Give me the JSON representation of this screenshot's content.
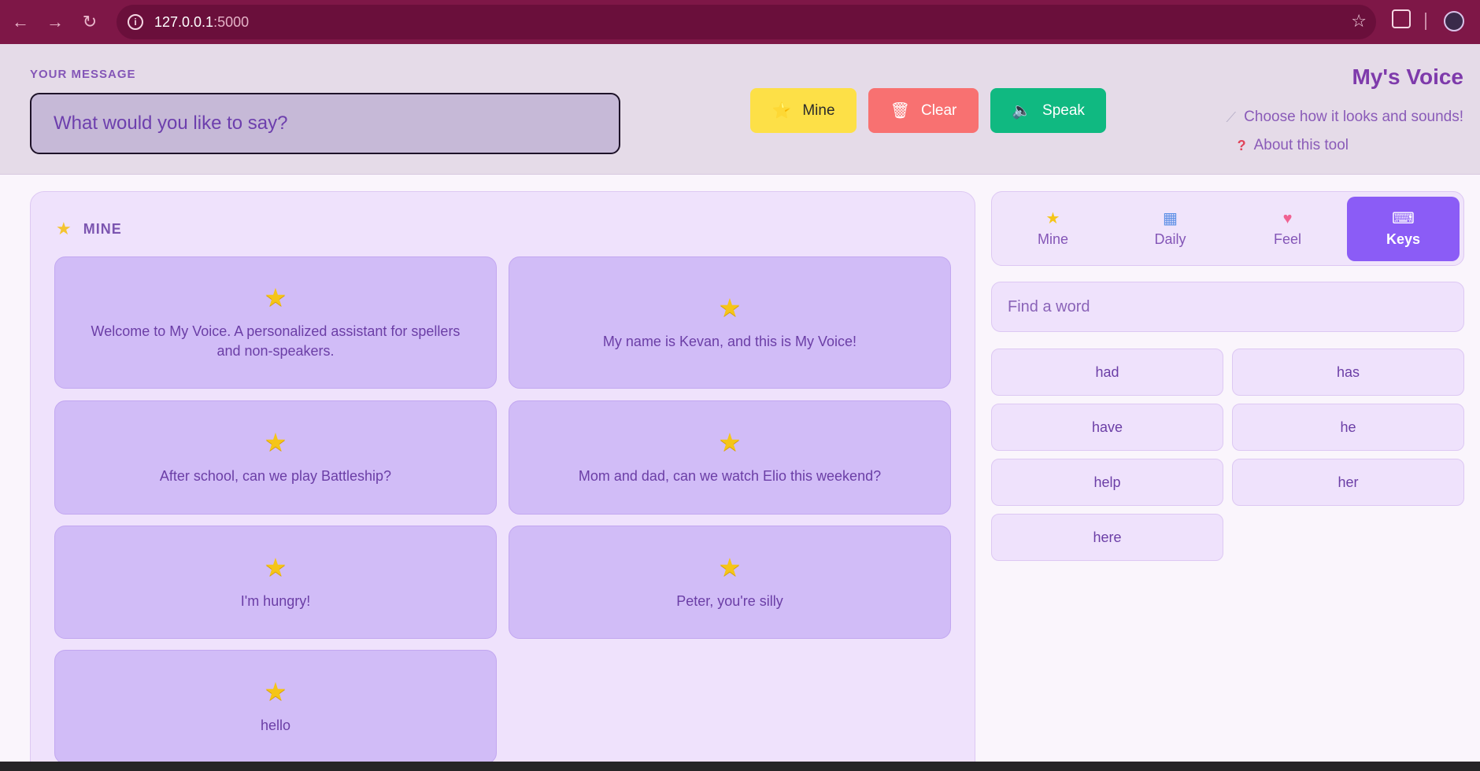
{
  "browser": {
    "url_host": "127.0.0.1",
    "url_port": ":5000"
  },
  "header": {
    "message_label": "YOUR MESSAGE",
    "message_placeholder": "What would you like to say?",
    "buttons": {
      "mine": "Mine",
      "clear": "Clear",
      "speak": "Speak"
    },
    "app_title": "My's Voice",
    "links": {
      "customize": "Choose how it looks and sounds!",
      "about": "About this tool"
    }
  },
  "main": {
    "section_title": "MINE",
    "cards": [
      {
        "text": "Welcome to My Voice. A personalized assistant for spellers and non-speakers."
      },
      {
        "text": "My name is Kevan, and this is My Voice!"
      },
      {
        "text": "After school, can we play Battleship?"
      },
      {
        "text": "Mom and dad, can we watch Elio this weekend?"
      },
      {
        "text": "I'm hungry!"
      },
      {
        "text": "Peter, you're silly"
      },
      {
        "text": "hello"
      }
    ]
  },
  "side": {
    "tabs": [
      {
        "label": "Mine",
        "icon": "star-icon"
      },
      {
        "label": "Daily",
        "icon": "calendar-icon"
      },
      {
        "label": "Feel",
        "icon": "heart-icon"
      },
      {
        "label": "Keys",
        "icon": "keyboard-icon"
      }
    ],
    "active_tab": "Keys",
    "search_placeholder": "Find a word",
    "words": [
      "had",
      "has",
      "have",
      "he",
      "help",
      "her",
      "here"
    ]
  },
  "colors": {
    "browser_bar": "#7e1747",
    "accent": "#8b5cf6",
    "mine_button": "#fde047",
    "clear_button": "#f87171",
    "speak_button": "#10b981",
    "card": "#d1bcf7"
  }
}
